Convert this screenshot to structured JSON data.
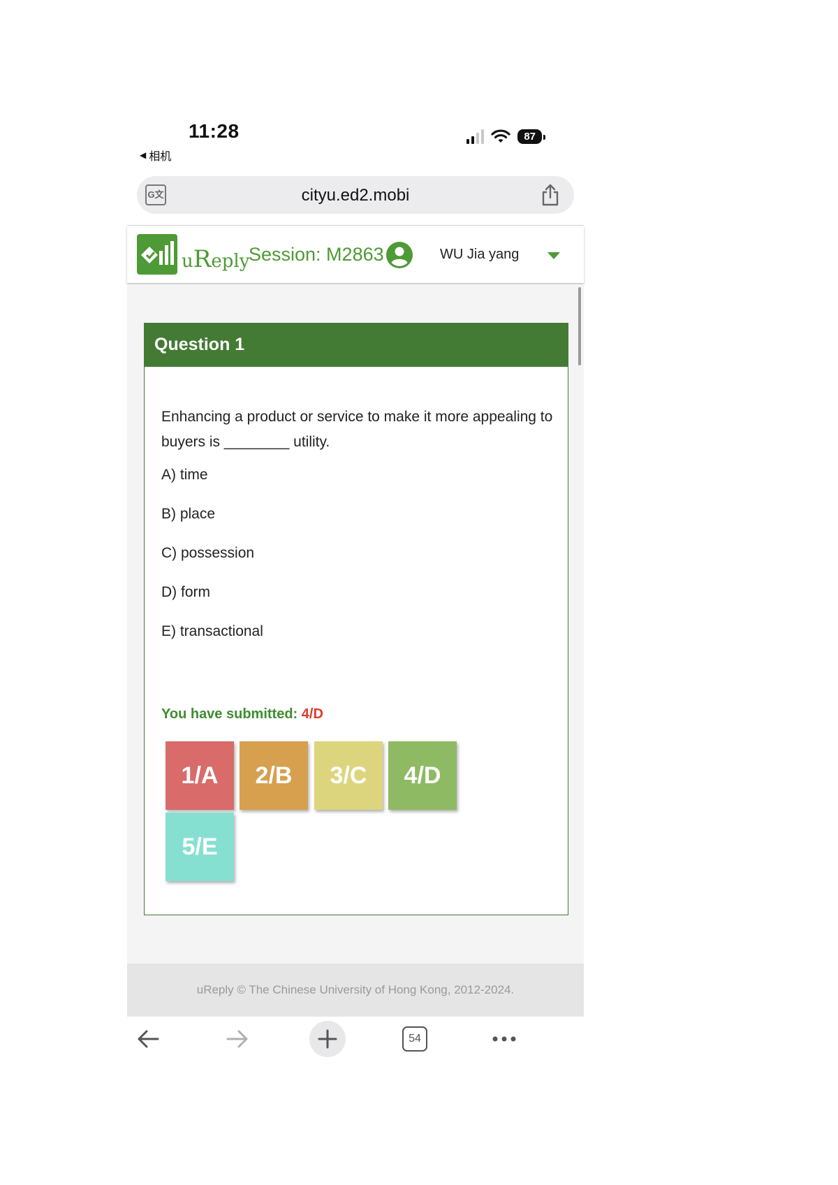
{
  "status_bar": {
    "time": "11:28",
    "back_app": "相机",
    "battery": "87"
  },
  "browser": {
    "url": "cityu.ed2.mobi",
    "tab_count": "54"
  },
  "header": {
    "logo_text_u": "u",
    "logo_text_r": "R",
    "logo_text_eply": "eply",
    "session": "Session: M2863",
    "user_name": "WU Jia yang"
  },
  "question": {
    "title": "Question 1",
    "text": "Enhancing a product or service to make it more appealing to buyers is ________ utility.",
    "options": [
      "A) time",
      "B) place",
      "C) possession",
      "D) form",
      "E) transactional"
    ],
    "submitted_label": "You have submitted:",
    "submitted_answer": "4/D"
  },
  "choices": [
    {
      "label": "1/A",
      "color": "#d96b6b"
    },
    {
      "label": "2/B",
      "color": "#d6a04f"
    },
    {
      "label": "3/C",
      "color": "#dcd57e"
    },
    {
      "label": "4/D",
      "color": "#8fba64"
    },
    {
      "label": "5/E",
      "color": "#86e0d2"
    }
  ],
  "footer": {
    "text": "uReply © The Chinese University of Hong Kong, 2012-2024."
  },
  "colors": {
    "brand_green": "#4e9a36",
    "card_header": "#437a34",
    "submitted_answer": "#e03a2c"
  }
}
